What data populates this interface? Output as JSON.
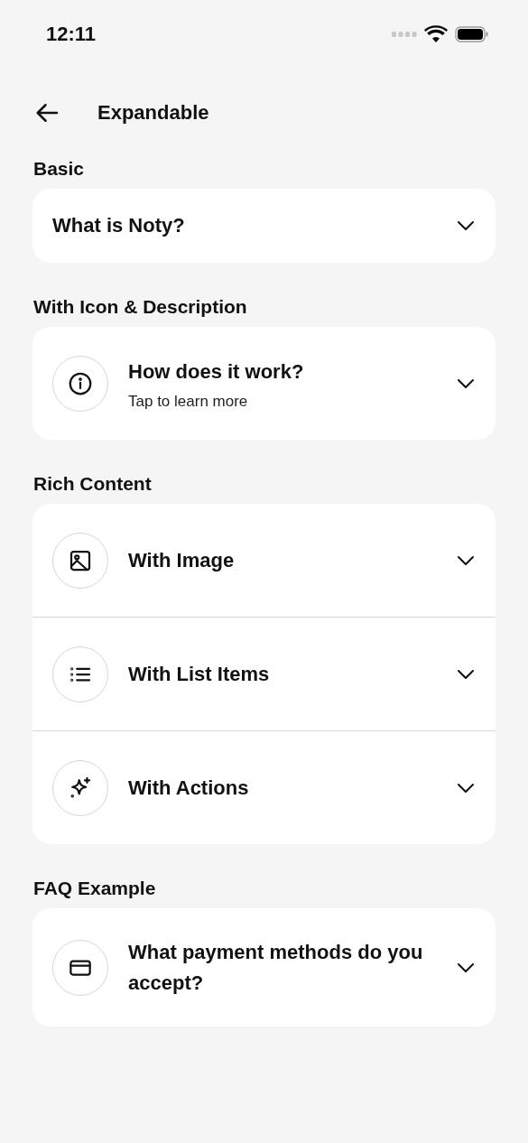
{
  "status_bar": {
    "time": "12:11"
  },
  "header": {
    "title": "Expandable"
  },
  "sections": [
    {
      "title": "Basic",
      "items": [
        {
          "kind": "plain",
          "title": "What is Noty?",
          "expanded": false
        }
      ]
    },
    {
      "title": "With Icon & Description",
      "items": [
        {
          "kind": "info",
          "title": "How does it work?",
          "description": "Tap to learn more",
          "expanded": false
        }
      ]
    },
    {
      "title": "Rich Content",
      "items": [
        {
          "kind": "image",
          "title": "With Image",
          "expanded": false
        },
        {
          "kind": "list",
          "title": "With List Items",
          "expanded": false
        },
        {
          "kind": "sparkle",
          "title": "With Actions",
          "expanded": false
        }
      ]
    },
    {
      "title": "FAQ Example",
      "items": [
        {
          "kind": "card",
          "title": "What payment methods do you accept?",
          "expanded": false
        }
      ]
    }
  ]
}
